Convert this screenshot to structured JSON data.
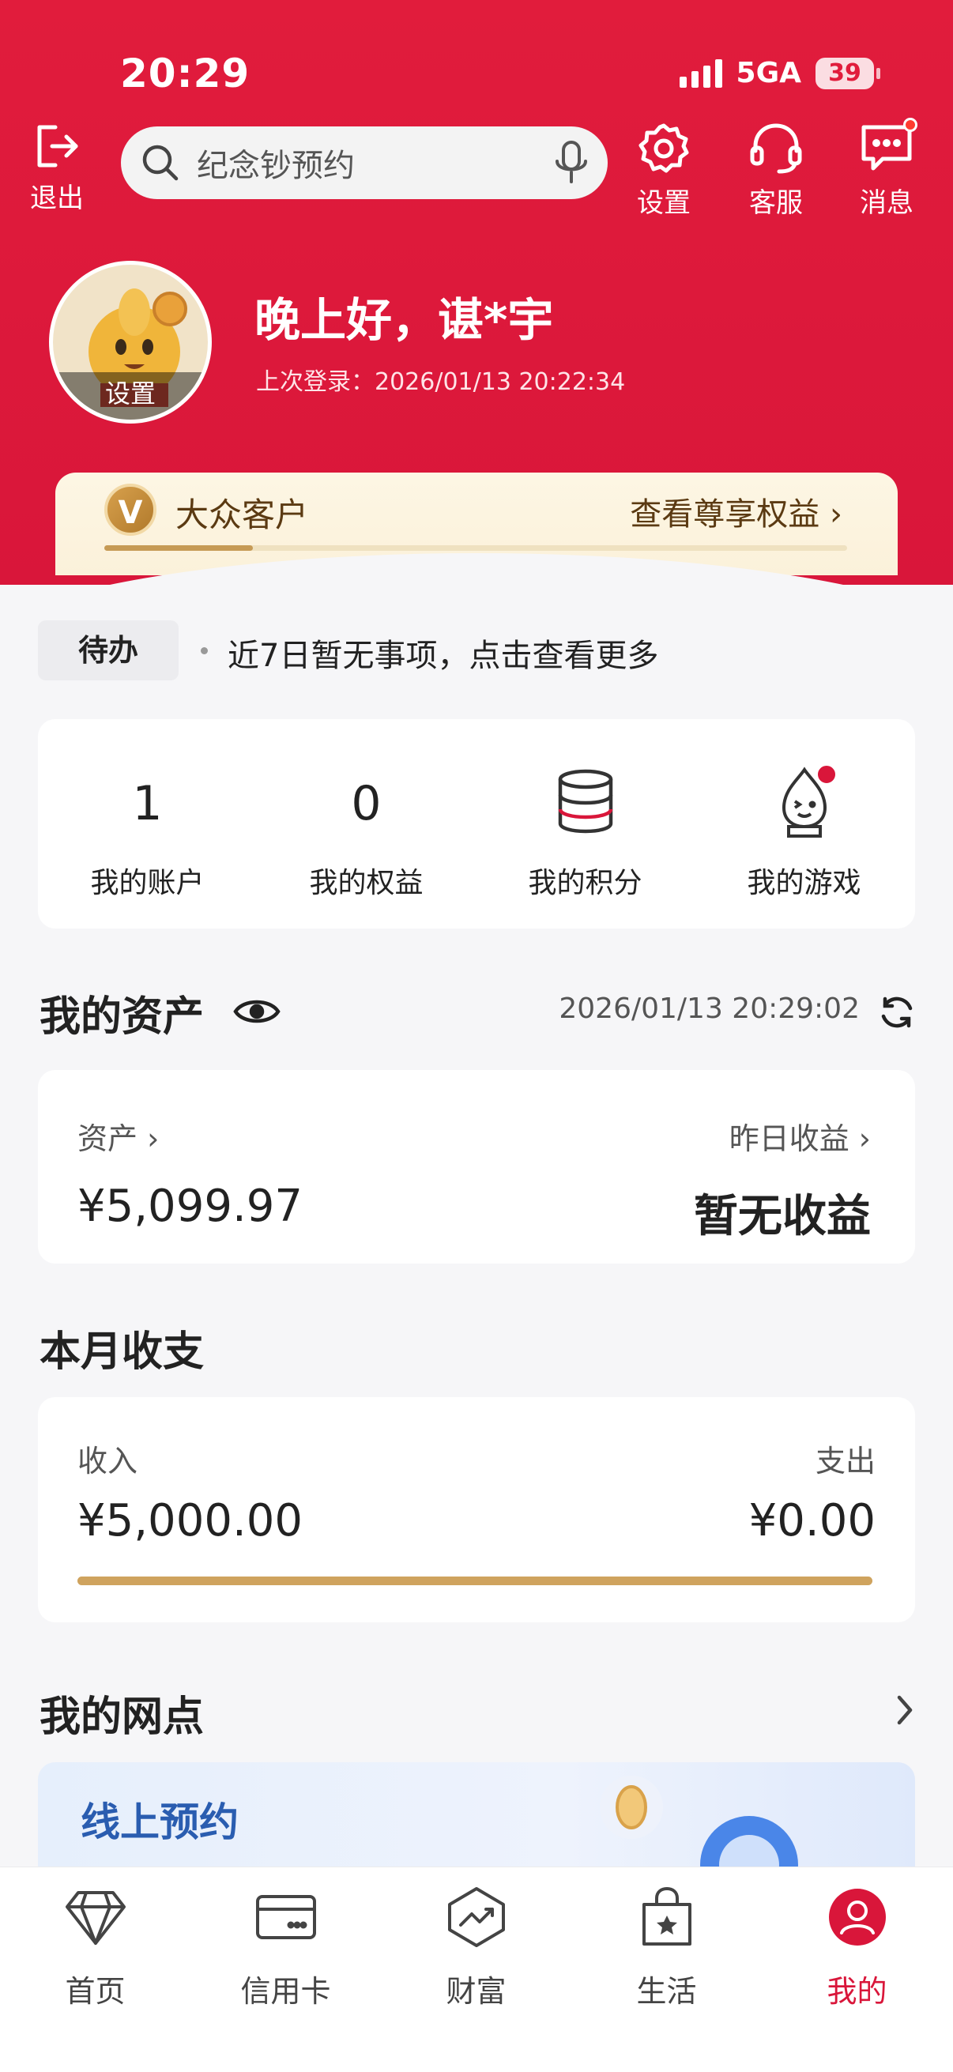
{
  "status_bar": {
    "time": "20:29",
    "network": "5GA",
    "battery": "39"
  },
  "topbar": {
    "exit_label": "退出",
    "search_placeholder": "纪念钞预约",
    "settings_label": "设置",
    "service_label": "客服",
    "message_label": "消息"
  },
  "profile": {
    "avatar_label": "设置",
    "greeting": "晚上好，谌*宇",
    "last_login": "上次登录：2026/01/13 20:22:34"
  },
  "vip": {
    "badge": "V",
    "level": "大众客户",
    "link": "查看尊享权益 ›",
    "progress": 0.2
  },
  "todo": {
    "tag": "待办",
    "text": "近7日暂无事项，点击查看更多"
  },
  "quick": [
    {
      "value": "1",
      "label": "我的账户",
      "icon": ""
    },
    {
      "value": "0",
      "label": "我的权益",
      "icon": ""
    },
    {
      "value": "",
      "label": "我的积分",
      "icon": "database-icon"
    },
    {
      "value": "",
      "label": "我的游戏",
      "icon": "mascot-icon"
    }
  ],
  "assets": {
    "title": "我的资产",
    "time": "2026/01/13 20:29:02",
    "assets_label": "资产 ›",
    "assets_value": "¥5,099.97",
    "yesterday_label": "昨日收益 ›",
    "yesterday_value": "暂无收益"
  },
  "monthly": {
    "title": "本月收支",
    "income_label": "收入",
    "income_value": "¥5,000.00",
    "expense_label": "支出",
    "expense_value": "¥0.00",
    "income_share": 1.0
  },
  "branch": {
    "title": "我的网点",
    "card_title": "线上预约"
  },
  "nav": [
    {
      "label": "首页",
      "icon": "diamond-icon"
    },
    {
      "label": "信用卡",
      "icon": "credit-card-icon"
    },
    {
      "label": "财富",
      "icon": "trend-chart-icon"
    },
    {
      "label": "生活",
      "icon": "shopping-bag-icon"
    },
    {
      "label": "我的",
      "icon": "user-icon",
      "active": true
    }
  ],
  "colors": {
    "brand_red": "#d9163a",
    "gold": "#cfa35e",
    "link_blue": "#2a5db0"
  }
}
